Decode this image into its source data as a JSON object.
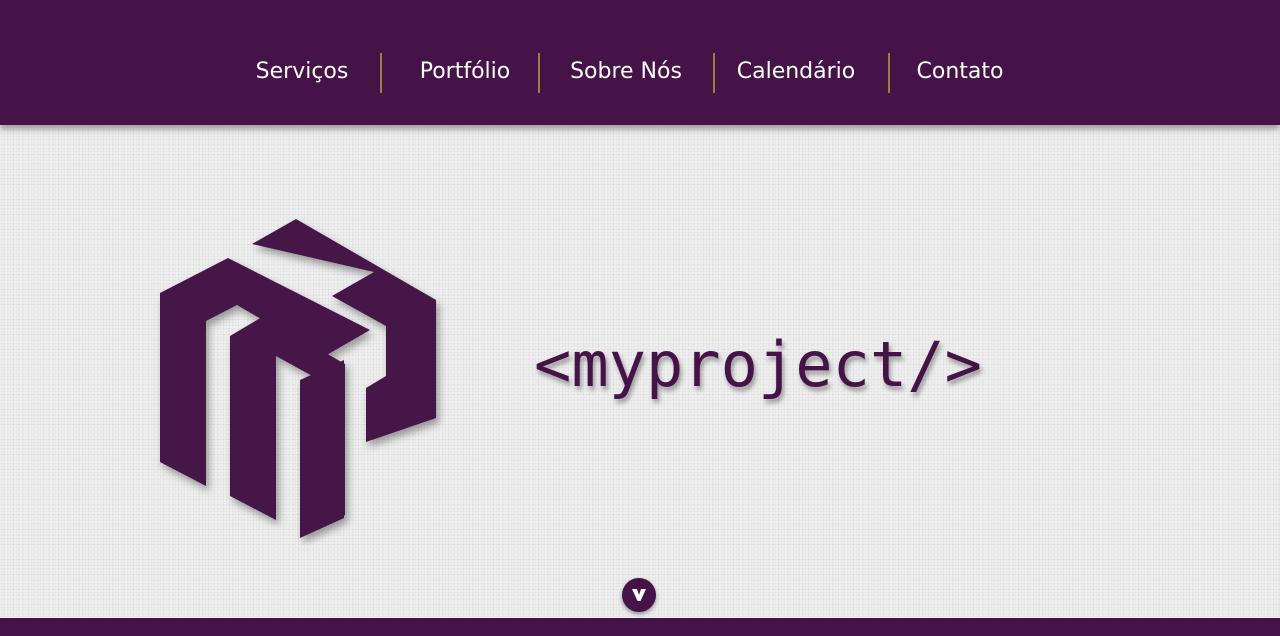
{
  "nav": {
    "items": [
      {
        "label": "Serviços"
      },
      {
        "label": "Portfólio"
      },
      {
        "label": "Sobre Nós"
      },
      {
        "label": "Calendário"
      },
      {
        "label": "Contato"
      }
    ]
  },
  "hero": {
    "logo_icon": "cube-m-logo-icon",
    "brand_name": "<myproject/>"
  },
  "scroll_button": {
    "icon": "chevron-down-icon"
  },
  "colors": {
    "brand": "#451347",
    "divider": "#a17a45",
    "background": "#efefef"
  }
}
